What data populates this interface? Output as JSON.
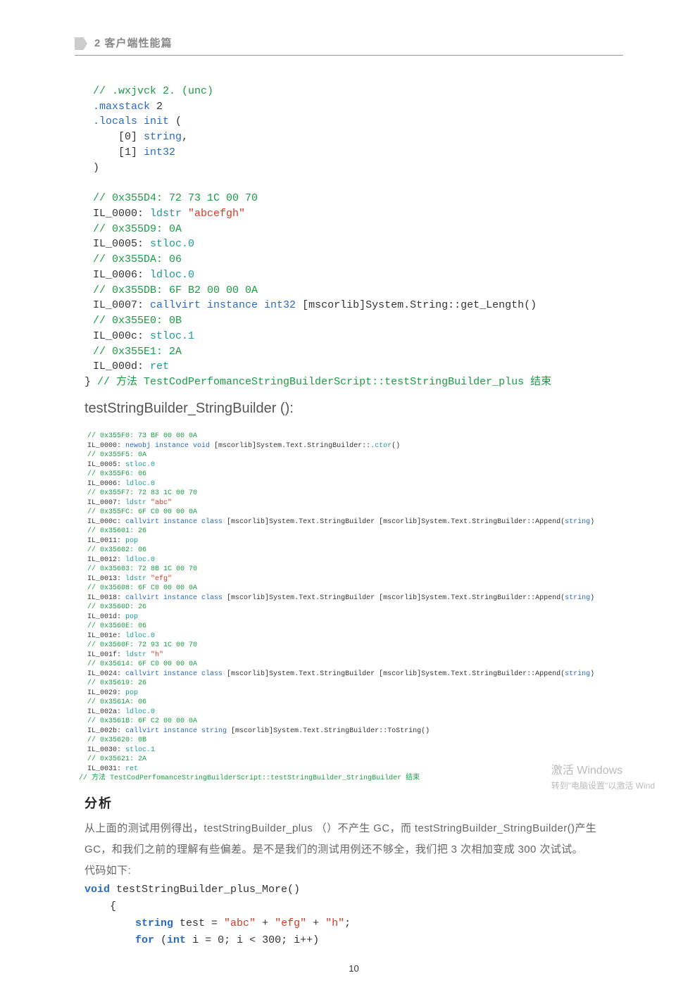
{
  "chapter": {
    "title": "2 客户端性能篇"
  },
  "code1": {
    "l01a": "// .wxjvck 2. (unc)",
    "l01": ".maxstack",
    "l01n": " 2",
    "l02": ".locals init",
    "l02p": " (",
    "l03a": "    [",
    "l03n": "0",
    "l03b": "] ",
    "l03t": "string",
    "l03c": ",",
    "l04a": "    [",
    "l04n": "1",
    "l04b": "] ",
    "l04t": "int32",
    "l05": ")",
    "c1": "// 0x355D4: 72 73 1C 00 70",
    "i1a": "IL_0000: ",
    "i1b": "ldstr ",
    "i1s": "\"abcefgh\"",
    "c2": "// 0x355D9: 0A",
    "i2a": "IL_0005: ",
    "i2b": "stloc.0",
    "c3": "// 0x355DA: 06",
    "i3a": "IL_0006: ",
    "i3b": "ldloc.0",
    "c4": "// 0x355DB: 6F B2 00 00 0A",
    "i4a": "IL_0007: ",
    "i4b": "callvirt instance int32 ",
    "i4c": "[mscorlib]System.String::get_Length()",
    "c5": "// 0x355E0: 0B",
    "i5a": "IL_000c: ",
    "i5b": "stloc.1",
    "c6": "// 0x355E1: 2A",
    "i6a": "IL_000d: ",
    "i6b": "ret",
    "end1": "} ",
    "end2": "// 方法 TestCodPerfomanceStringBuilderScript::testStringBuilder_plus 结束"
  },
  "section2": {
    "title": "testStringBuilder_StringBuilder ():"
  },
  "code2": {
    "c1": "// 0x355F0: 73 BF 00 00 0A",
    "i1": "IL_0000: ",
    "i1b": "newobj instance void ",
    "i1c": "[mscorlib]System.Text.StringBuilder::",
    "i1d": ".ctor",
    "i1e": "()",
    "c2": "// 0x355F5: 0A",
    "i2": "IL_0005: ",
    "i2b": "stloc.0",
    "c3": "// 0x355F6: 06",
    "i3": "IL_0006: ",
    "i3b": "ldloc.0",
    "c4": "// 0x355F7: 72 83 1C 00 70",
    "i4": "IL_0007: ",
    "i4b": "ldstr ",
    "i4s": "\"abc\"",
    "c5": "// 0x355FC: 6F C0 00 00 0A",
    "i5": "IL_000c: ",
    "i5b": "callvirt instance class ",
    "i5c": "[mscorlib]System.Text.StringBuilder [mscorlib]System.Text.StringBuilder::Append(",
    "i5d": "string",
    "i5e": ")",
    "c6": "// 0x35601: 26",
    "i6": "IL_0011: ",
    "i6b": "pop",
    "c7": "// 0x35602: 06",
    "i7": "IL_0012: ",
    "i7b": "ldloc.0",
    "c8": "// 0x35603: 72 8B 1C 00 70",
    "i8": "IL_0013: ",
    "i8b": "ldstr ",
    "i8s": "\"efg\"",
    "c9": "// 0x35608: 6F C0 00 00 0A",
    "i9": "IL_0018: ",
    "i9b": "callvirt instance class ",
    "i9c": "[mscorlib]System.Text.StringBuilder [mscorlib]System.Text.StringBuilder::Append(",
    "i9d": "string",
    "i9e": ")",
    "c10": "// 0x3560D: 26",
    "i10": "IL_001d: ",
    "i10b": "pop",
    "c11": "// 0x3560E: 06",
    "i11": "IL_001e: ",
    "i11b": "ldloc.0",
    "c12": "// 0x3560F: 72 93 1C 00 70",
    "i12": "IL_001f: ",
    "i12b": "ldstr ",
    "i12s": "\"h\"",
    "c13": "// 0x35614: 6F C0 00 00 0A",
    "i13": "IL_0024: ",
    "i13b": "callvirt instance class ",
    "i13c": "[mscorlib]System.Text.StringBuilder [mscorlib]System.Text.StringBuilder::Append(",
    "i13d": "string",
    "i13e": ")",
    "c14": "// 0x35619: 26",
    "i14": "IL_0029: ",
    "i14b": "pop",
    "c15": "// 0x3561A: 06",
    "i15": "IL_002a: ",
    "i15b": "ldloc.0",
    "c16": "// 0x3561B: 6F C2 00 00 0A",
    "i16": "IL_002b: ",
    "i16b": "callvirt instance string ",
    "i16c": "[mscorlib]System.Text.StringBuilder::ToString()",
    "c17": "// 0x35620: 0B",
    "i17": "IL_0030: ",
    "i17b": "stloc.1",
    "c18": "// 0x35621: 2A",
    "i18": "IL_0031: ",
    "i18b": "ret",
    "end": "// 方法 TestCodPerfomanceStringBuilderScript::testStringBuilder_StringBuilder 结束"
  },
  "analysis": {
    "title": "分析",
    "p1": "从上面的测试用例得出，testStringBuilder_plus （）不产生 GC，而 testStringBuilder_StringBuilder()产生 GC，和我们之前的理解有些偏差。是不是我们的测试用例还不够全，我们把 3 次相加变成 300 次试试。",
    "p2": "代码如下:"
  },
  "code3": {
    "kw_void": "void",
    "fn": " testStringBuilder_plus_More()",
    "lb": "    {",
    "kw_string": "string",
    "l1a": " test = ",
    "s1": "\"abc\"",
    "l1b": " + ",
    "s2": "\"efg\"",
    "l1c": " + ",
    "s3": "\"h\"",
    "l1d": ";",
    "kw_for": "for",
    "l2a": " (",
    "kw_int": "int",
    "l2b": " i = ",
    "n0": "0",
    "l2c": "; i < ",
    "n300": "300",
    "l2d": "; i++)"
  },
  "windows": {
    "l1": "激活 Windows",
    "l2": "转到\"电脑设置\"以激活 Wind"
  },
  "page_num": "10"
}
